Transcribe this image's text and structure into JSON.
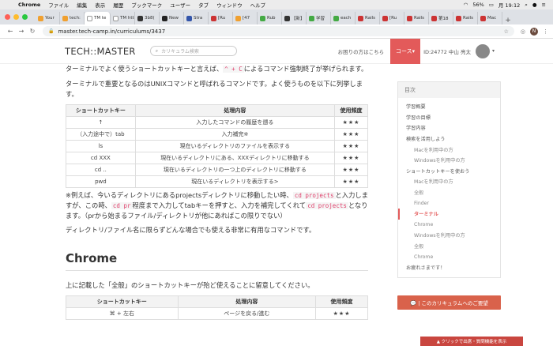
{
  "menubar": {
    "app": "Chrome",
    "items": [
      "ファイル",
      "編集",
      "表示",
      "履歴",
      "ブックマーク",
      "ユーザー",
      "タブ",
      "ウィンドウ",
      "ヘルプ"
    ],
    "battery": "56%",
    "clock": "月 19:12"
  },
  "tabs": [
    {
      "label": "Your",
      "color": "#f0a030"
    },
    {
      "label": "tech:",
      "color": "#f0a030"
    },
    {
      "label": "TM te",
      "color": "#ffffff",
      "active": true
    },
    {
      "label": "TM http:",
      "color": "#ffffff"
    },
    {
      "label": "3b8(",
      "color": "#333333"
    },
    {
      "label": "New",
      "color": "#222222"
    },
    {
      "label": "Stra",
      "color": "#3355aa"
    },
    {
      "label": "[Ru",
      "color": "#cc3333"
    },
    {
      "label": "[47",
      "color": "#f0a030"
    },
    {
      "label": "Rub",
      "color": "#44aa44"
    },
    {
      "label": "【新】",
      "color": "#333333"
    },
    {
      "label": "学習",
      "color": "#44aa44"
    },
    {
      "label": "each",
      "color": "#44aa44"
    },
    {
      "label": "Rails",
      "color": "#cc3333"
    },
    {
      "label": "[Ru",
      "color": "#cc3333"
    },
    {
      "label": "Rails",
      "color": "#cc3333"
    },
    {
      "label": "第18",
      "color": "#cc3333"
    },
    {
      "label": "Rails",
      "color": "#cc3333"
    },
    {
      "label": "Mac",
      "color": "#cc3333"
    }
  ],
  "address": {
    "url": "master.tech-camp.in/curriculums/3437",
    "profile_initial": "N"
  },
  "site": {
    "logo": "TECH::MASTER",
    "search_placeholder": "カリキュラム検索",
    "help": "お困りの方はこちら",
    "course_btn": "コース▾",
    "user_id": "ID:24772 中山 亮太"
  },
  "content": {
    "intro_p1_before": "ターミナルでよく使うショートカットキーと言えば、",
    "intro_p1_code": "^ + C",
    "intro_p1_after": "によるコマンド強制終了が挙げられます。",
    "intro_p2": "ターミナルで重要となるのはUNIXコマンドと呼ばれるコマンドです。よく使うものを以下に列挙します。",
    "table1_headers": [
      "ショートカットキー",
      "処理内容",
      "使用頻度"
    ],
    "table1_rows": [
      [
        "↑",
        "入力したコマンドの履歴を遡る",
        "★★★"
      ],
      [
        "（入力途中で）tab",
        "入力補完※",
        "★★★"
      ],
      [
        "ls",
        "現在いるディレクトリのファイルを表示する",
        "★★★"
      ],
      [
        "cd XXX",
        "現在いるディレクトリにある、XXXディレクトリに移動する",
        "★★★"
      ],
      [
        "cd ..",
        "現在いるディレクトリの一つ上のディレクトリに移動する",
        "★★★"
      ],
      [
        "pwd",
        "現在いるディレクトリを表示する>",
        "★★★"
      ]
    ],
    "note_a": "※例えば、今いるディレクトリにあるprojectsディレクトリに移動したい時、",
    "note_code1": "cd projects",
    "note_b": "と入力しますが、この時、",
    "note_code2": "cd pr",
    "note_c": "程度まで入力してtabキーを押すと、入力を補完してくれて",
    "note_code3": "cd projects",
    "note_d": "となります。（prから始まるファイル/ディレクトリが他にあればこの限りでない）",
    "p_dir": "ディレクトリ/ファイル名に限らずどんな場合でも使える非常に有用なコマンドです。",
    "h2": "Chrome",
    "p_chrome": "上に記載した「全般」のショートカットキーが殆ど使えることに留意してください。",
    "table2_headers": [
      "ショートカットキー",
      "処理内容",
      "使用頻度"
    ],
    "table2_rows": [
      [
        "⌘ + 左右",
        "ページを戻る/進む",
        "★★★"
      ]
    ]
  },
  "toc": {
    "title": "目次",
    "items": [
      {
        "label": "学習概要",
        "level": 0
      },
      {
        "label": "学習の目標",
        "level": 0
      },
      {
        "label": "学習内容",
        "level": 0
      },
      {
        "label": "検索を活用しよう",
        "level": 0
      },
      {
        "label": "Macを利用中の方",
        "level": 1
      },
      {
        "label": "Windowsを利用中の方",
        "level": 1
      },
      {
        "label": "ショートカットキーを使おう",
        "level": 0
      },
      {
        "label": "Macを利用中の方",
        "level": 1
      },
      {
        "label": "全般",
        "level": 1
      },
      {
        "label": "Finder",
        "level": 1
      },
      {
        "label": "ターミナル",
        "level": 1,
        "active": true
      },
      {
        "label": "Chrome",
        "level": 1
      },
      {
        "label": "Windowsを利用中の方",
        "level": 1
      },
      {
        "label": "全般",
        "level": 1
      },
      {
        "label": "Chrome",
        "level": 1
      },
      {
        "label": "お疲れさまです！",
        "level": 0
      }
    ],
    "feedback": "💬 | このカリキュラムへのご要望"
  },
  "bottombar": "▲ クリックで出席・質問機能を表示"
}
